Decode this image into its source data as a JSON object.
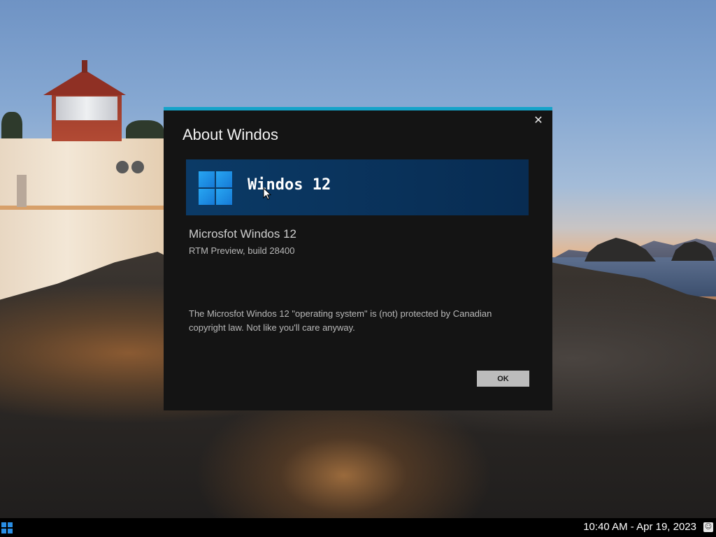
{
  "dialog": {
    "title": "About Windos",
    "close_icon": "close-icon",
    "banner_title": "Windos 12",
    "product_name": "Microsfot Windos 12",
    "build_info": "RTM Preview, build 28400",
    "legal_text": "The Microsfot Windos 12 \"operating system\" is (not) protected by Canadian copyright law. Not like you'll care anyway.",
    "ok_label": "OK"
  },
  "taskbar": {
    "start_icon": "windows-logo-icon",
    "clock": "10:40 AM - Apr 19, 2023",
    "notification_icon": "notification-icon"
  },
  "colors": {
    "accent": "#16a3c9",
    "dialog_bg": "#141414",
    "banner_bg": "#0b3a66",
    "logo_blue": "#1f8fe8",
    "ok_button_bg": "#bcbcbc",
    "taskbar_bg": "#000000"
  }
}
